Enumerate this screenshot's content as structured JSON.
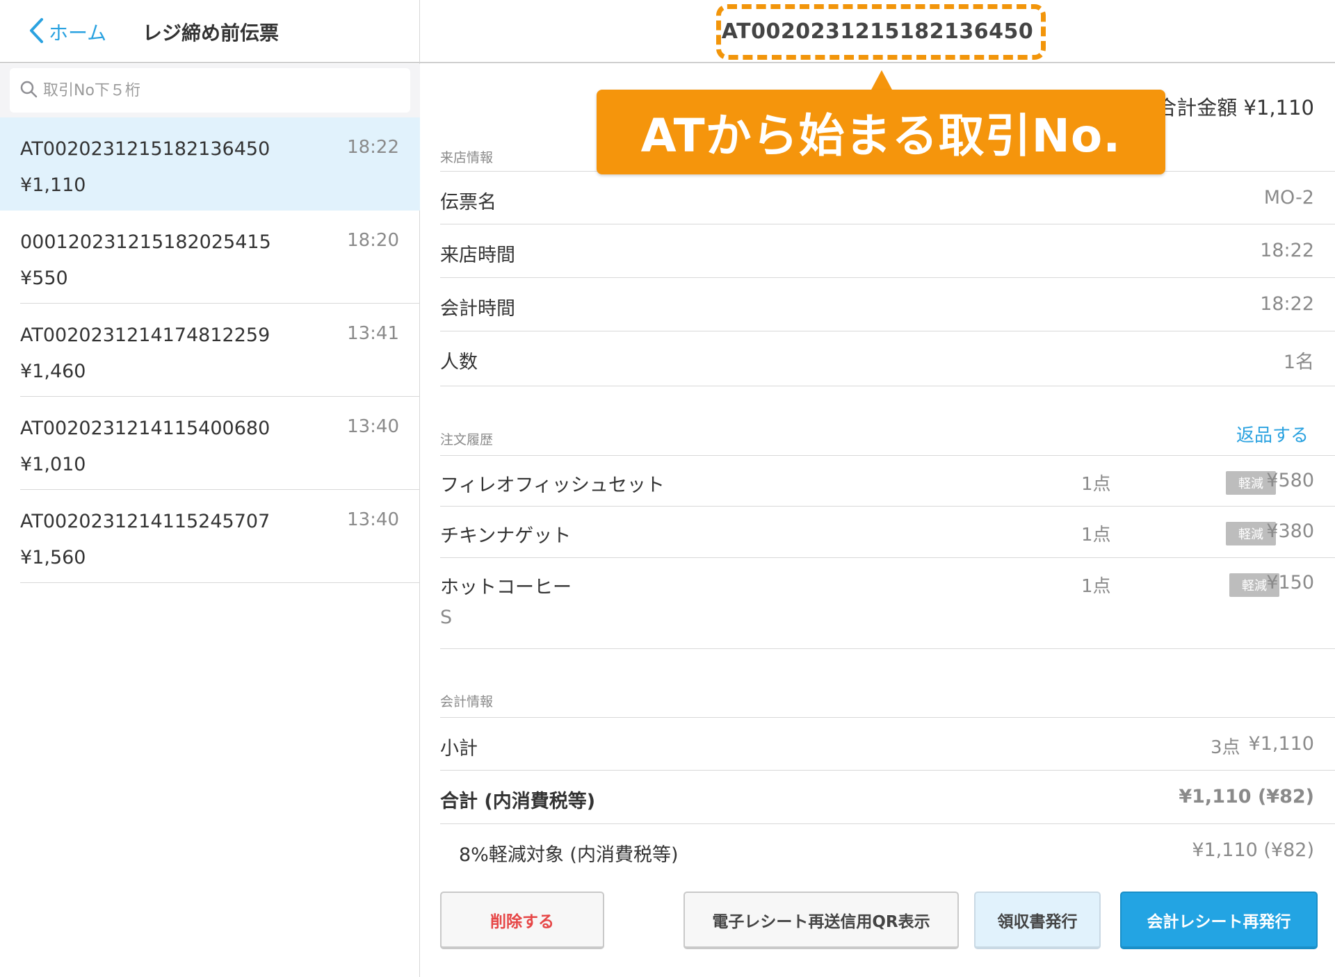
{
  "sidebar": {
    "back_label": "ホーム",
    "title": "レジ締め前伝票",
    "search_placeholder": "取引No下５桁",
    "transactions": [
      {
        "id": "AT0020231215182136450",
        "amount": "¥1,110",
        "time": "18:22",
        "selected": true
      },
      {
        "id": "000120231215182025415",
        "amount": "¥550",
        "time": "18:20",
        "selected": false
      },
      {
        "id": "AT0020231214174812259",
        "amount": "¥1,460",
        "time": "13:41",
        "selected": false
      },
      {
        "id": "AT0020231214115400680",
        "amount": "¥1,010",
        "time": "13:40",
        "selected": false
      },
      {
        "id": "AT0020231214115245707",
        "amount": "¥1,560",
        "time": "13:40",
        "selected": false
      }
    ]
  },
  "main": {
    "header_id": "AT0020231215182136450",
    "callout": "ATから始まる取引No.",
    "total_top": "合計金額 ¥1,110",
    "visit_section": "来店情報",
    "visit_rows": [
      {
        "label": "伝票名",
        "value": "MO-2"
      },
      {
        "label": "来店時間",
        "value": "18:22"
      },
      {
        "label": "会計時間",
        "value": "18:22"
      },
      {
        "label": "人数",
        "value": "1名"
      }
    ],
    "order_section": "注文履歴",
    "return_label": "返品する",
    "orders": [
      {
        "name": "フィレオフィッシュセット",
        "sub": "",
        "qty": "1点",
        "badge": "軽減",
        "price": "¥580"
      },
      {
        "name": "チキンナゲット",
        "sub": "",
        "qty": "1点",
        "badge": "軽減",
        "price": "¥380"
      },
      {
        "name": "ホットコーヒー",
        "sub": "S",
        "qty": "1点",
        "badge": "軽減",
        "price": "¥150"
      }
    ],
    "payment_section": "会計情報",
    "subtotal": {
      "label": "小計",
      "qty": "3点",
      "value": "¥1,110"
    },
    "total": {
      "label": "合計 (内消費税等)",
      "value": "¥1,110 (¥82)"
    },
    "reduced": {
      "label": "8%軽減対象 (内消費税等)",
      "value": "¥1,110 (¥82)"
    },
    "buttons": {
      "delete": "削除する",
      "qr": "電子レシート再送信用QR表示",
      "receipt": "領収書発行",
      "reissue": "会計レシート再発行"
    }
  },
  "colors": {
    "accent": "#2aa2e0",
    "callout": "#f5950c",
    "selected_row": "#e1f2fc",
    "delete_text": "#e64646"
  }
}
